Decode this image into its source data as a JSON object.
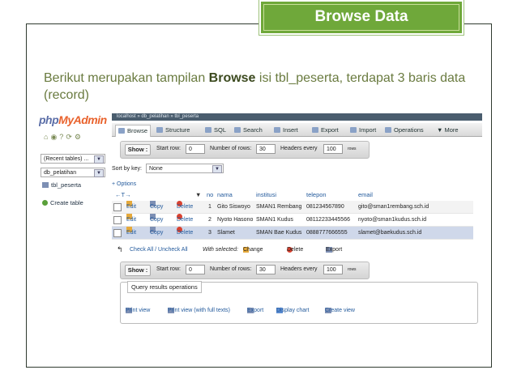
{
  "slide": {
    "title": "Browse Data",
    "caption_before": "Berikut merupakan tampilan ",
    "caption_bold": "Browse",
    "caption_after": " isi tbl_peserta, terdapat 3 baris data (record)",
    "accent_color": "#6fa83a"
  },
  "pma": {
    "logo_php": "php",
    "logo_my": "MyAdmin",
    "breadcrumb": "localhost » db_pelatihan » tbl_peserta",
    "recent_tables": "(Recent tables) ...",
    "database": "db_pelatihan",
    "table_link": "tbl_peserta",
    "create_table": "Create table",
    "tabs": [
      "Browse",
      "Structure",
      "SQL",
      "Search",
      "Insert",
      "Export",
      "Import",
      "Operations",
      "More"
    ],
    "nav": {
      "show_btn": "Show :",
      "start_row_label": "Start row:",
      "start_row": "0",
      "num_rows_label": "Number of rows:",
      "num_rows": "30",
      "headers_every_label": "Headers every",
      "headers_every": "100",
      "rows_label": "rows"
    },
    "sort_by_label": "Sort by key:",
    "sort_by_value": "None",
    "options_label": "+ Options",
    "arrows": "←T→",
    "columns": [
      "no",
      "nama",
      "institusi",
      "telepon",
      "email"
    ],
    "row_actions": {
      "edit": "Edit",
      "copy": "Copy",
      "delete": "Delete"
    },
    "rows": [
      {
        "no": "1",
        "nama": "Gito Siswoyo",
        "institusi": "SMAN1 Rembang",
        "telepon": "081234567890",
        "email": "gito@sman1rembang.sch.id"
      },
      {
        "no": "2",
        "nama": "Nyoto Hasono",
        "institusi": "SMAN1 Kudus",
        "telepon": "08112233445566",
        "email": "nyoto@sman1kudus.sch.id"
      },
      {
        "no": "3",
        "nama": "Slamet",
        "institusi": "SMAN Bae Kudus",
        "telepon": "0888777666555",
        "email": "slamet@baekudus.sch.id"
      }
    ],
    "check_all": "Check All / Uncheck All",
    "with_selected": "With selected:",
    "bulk_change": "Change",
    "bulk_delete": "Delete",
    "bulk_export": "Export",
    "qro_title": "Query results operations",
    "qro_links": [
      "Print view",
      "Print view (with full texts)",
      "Export",
      "Display chart",
      "Create view"
    ]
  }
}
